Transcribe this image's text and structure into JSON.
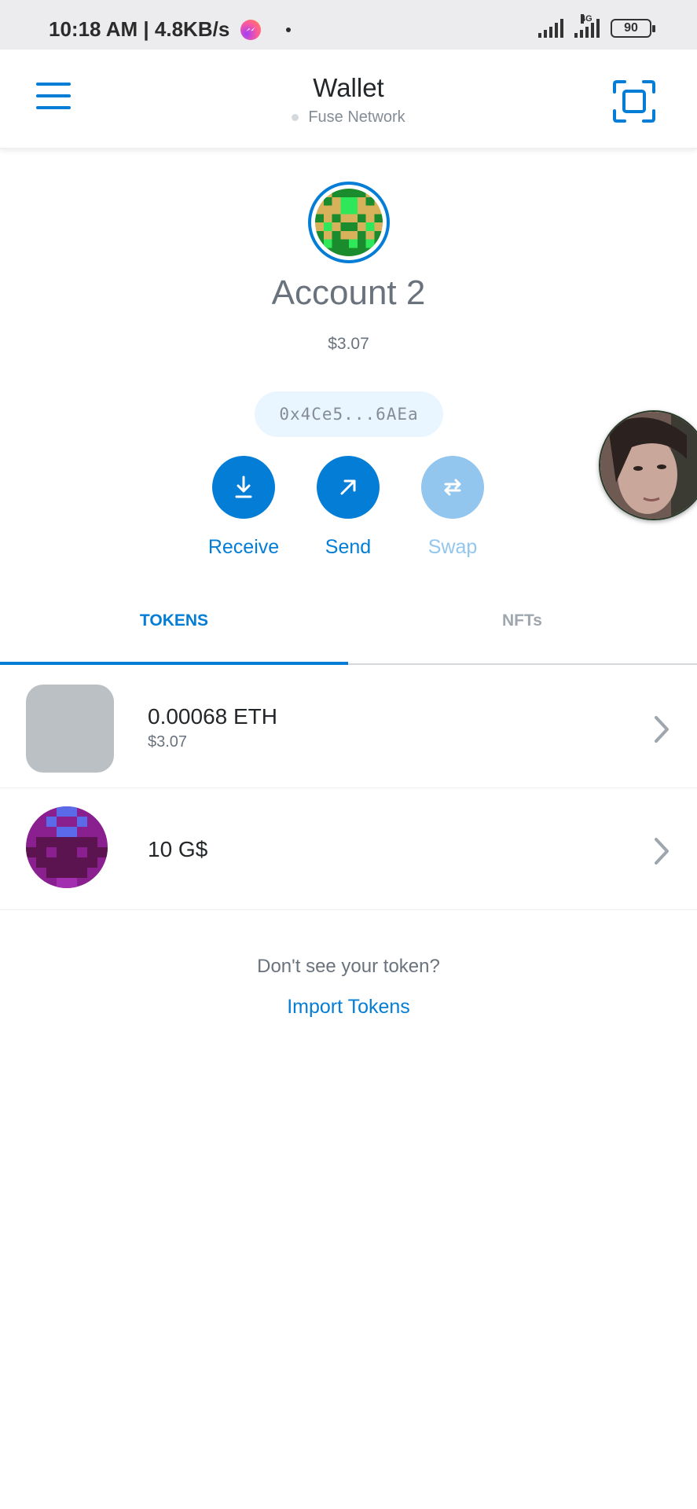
{
  "status_bar": {
    "time_speed": "10:18 AM | 4.8KB/s",
    "network_type": "4G",
    "battery": "90"
  },
  "header": {
    "title": "Wallet",
    "network": "Fuse Network"
  },
  "account": {
    "name": "Account 2",
    "balance": "$3.07",
    "address": "0x4Ce5...6AEa"
  },
  "actions": {
    "receive": "Receive",
    "send": "Send",
    "swap": "Swap"
  },
  "tabs": {
    "tokens": "TOKENS",
    "nfts": "NFTs"
  },
  "tokens": [
    {
      "amount": "0.00068 ETH",
      "fiat": "$3.07"
    },
    {
      "amount": "10 G$",
      "fiat": ""
    }
  ],
  "footer": {
    "hint": "Don't see your token?",
    "import": "Import Tokens"
  },
  "colors": {
    "accent": "#037dd6",
    "accent_disabled": "#92c6ee",
    "text_muted": "#6a737d"
  },
  "icons": [
    "messenger-icon",
    "hamburger-menu-icon",
    "qr-scan-icon",
    "receive-arrow-icon",
    "send-arrow-icon",
    "swap-icon",
    "chevron-right-icon"
  ]
}
